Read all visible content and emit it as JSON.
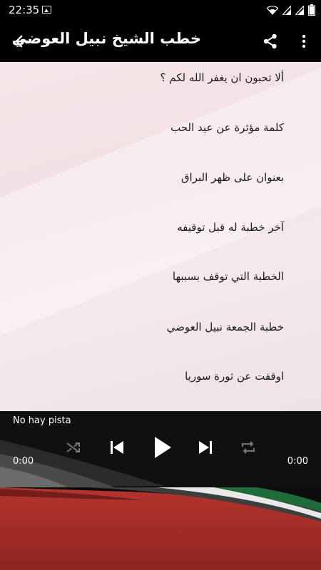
{
  "status_bar": {
    "time": "22:35",
    "battery_color": "#ffffff"
  },
  "app_bar": {
    "title": "خطب الشيخ نبيل العوضي",
    "icons": [
      "arrow-left-icon",
      "share-icon",
      "more-vert-icon"
    ]
  },
  "list": {
    "items": [
      "ألا تحبون ان يغفر الله لكم ؟",
      "كلمة مؤثرة عن عيد الحب",
      "بعنوان على ظهر البراق",
      "آخر خطبة له قبل توقيفه",
      "الخطبة التي توقف بسببها",
      "خطبة الجمعة نبيل العوضي",
      "اوقفت عن ثورة سوريا"
    ]
  },
  "player": {
    "track_name": "No hay pista",
    "time_elapsed": "0:00",
    "time_total": "0:00",
    "icons": [
      "shuffle-icon",
      "skip-previous-icon",
      "play-icon",
      "skip-next-icon",
      "repeat-icon"
    ]
  }
}
